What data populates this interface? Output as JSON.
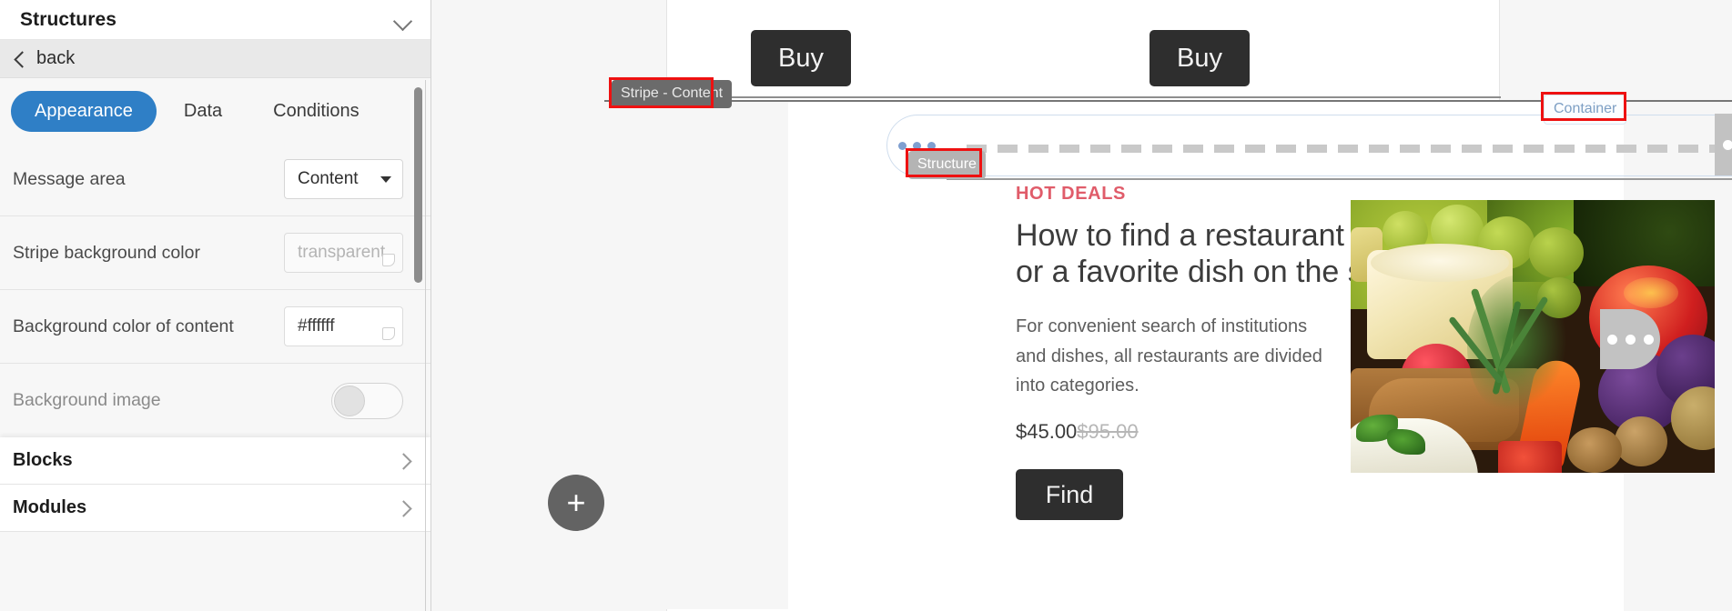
{
  "sidebar": {
    "title": "Structures",
    "collapse_icon": "chevron-down-icon",
    "back_label": "back",
    "back_icon": "chevron-left-icon",
    "tabs": [
      {
        "label": "Appearance",
        "active": true
      },
      {
        "label": "Data",
        "active": false
      },
      {
        "label": "Conditions",
        "active": false
      }
    ],
    "fields": [
      {
        "label": "Message area",
        "type": "select",
        "value": "Content"
      },
      {
        "label": "Stripe background color",
        "type": "color",
        "value": "transparent",
        "muted": true
      },
      {
        "label": "Background color of content",
        "type": "color",
        "value": "#ffffff",
        "muted": false
      },
      {
        "label": "Background image",
        "type": "toggle",
        "value": "off"
      }
    ],
    "sections": [
      {
        "label": "Blocks",
        "icon": "chevron-right-icon"
      },
      {
        "label": "Modules",
        "icon": "chevron-right-icon"
      }
    ]
  },
  "canvas": {
    "badges": {
      "stripe": "Stripe - Content",
      "structure": "Structure",
      "container": "Container"
    },
    "buy_buttons": [
      {
        "label": "Buy"
      },
      {
        "label": "Buy"
      }
    ],
    "handles": {
      "structure_drag": "drag-dots-icon",
      "more_grey_1": "more-options-icon",
      "more_grey_2": "more-options-icon",
      "more_dark_1": "more-options-icon",
      "add": "+"
    },
    "card": {
      "eyebrow": "HOT DEALS",
      "headline": "How to find a restaurant\nor a favorite dish on the site?",
      "body": "For convenient search of institutions\nand dishes, all restaurants are divided\ninto categories.",
      "price_new": "$45.00",
      "price_old": "$95.00",
      "cta": "Find",
      "image_alt": "food-photo"
    }
  },
  "colors": {
    "accent_blue": "#2f7fc6",
    "badge_dark": "#6b6b6b",
    "badge_grey": "#b4b4b4",
    "badge_lite_text": "#7d9fc4",
    "highlight_red": "#ee1111",
    "button_dark": "#2e2e2e",
    "eyebrow_red": "#e05c6a"
  }
}
